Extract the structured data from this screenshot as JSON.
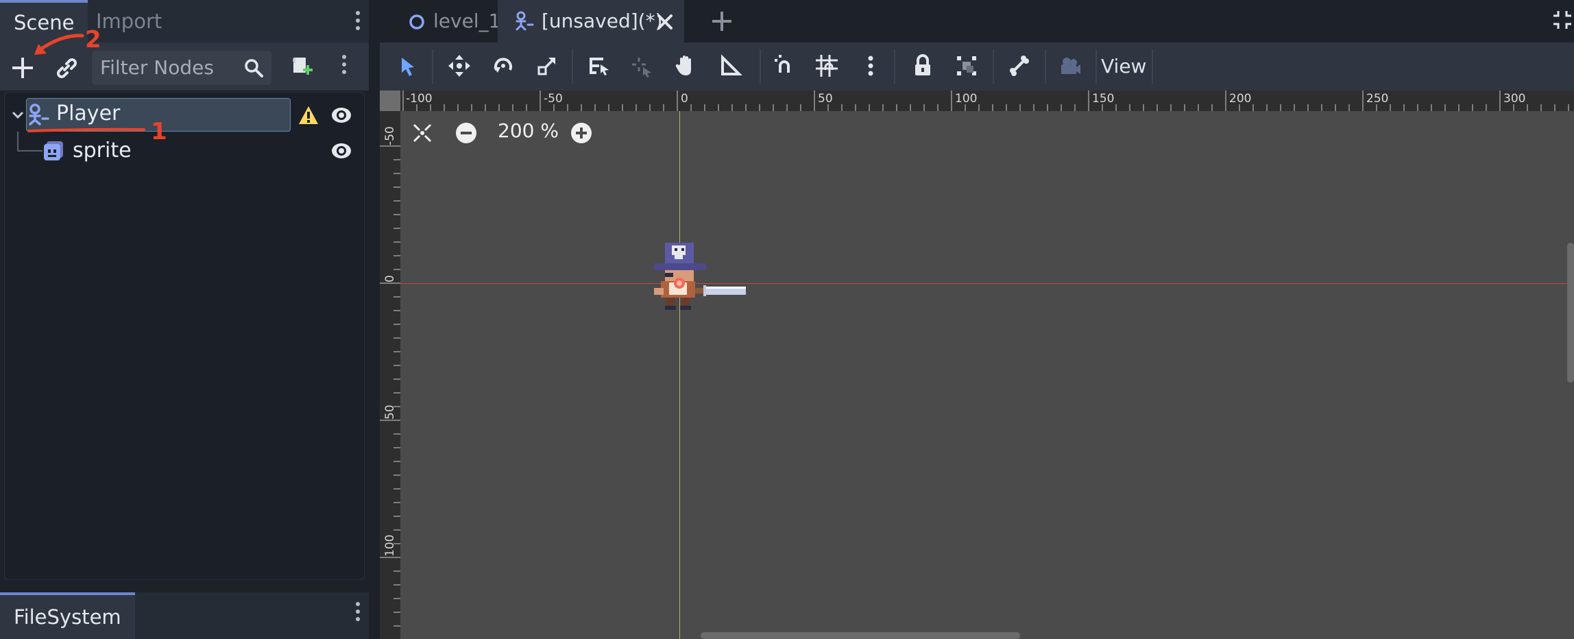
{
  "scene_dock": {
    "tabs": [
      {
        "label": "Scene"
      },
      {
        "label": "Import"
      }
    ],
    "filter_placeholder": "Filter Nodes",
    "tree": [
      {
        "label": "Player",
        "icon": "character-body-icon",
        "warning": true,
        "visible": true
      },
      {
        "label": "sprite",
        "icon": "sprite-icon",
        "visible": true
      }
    ],
    "annotations": {
      "marker_1": "1",
      "marker_2": "2",
      "color": "#e8442a"
    }
  },
  "filesystem_dock": {
    "tab_label": "FileSystem"
  },
  "editor_tabs": [
    {
      "label": "level_1",
      "icon": "circle-node-icon"
    },
    {
      "label": "[unsaved](*)",
      "icon": "character-body-icon",
      "active": true
    }
  ],
  "toolbar": {
    "view_label": "View"
  },
  "viewport": {
    "zoom_label": "200 %",
    "ruler_top_labels": [
      "-100",
      "-50",
      "0",
      "50",
      "100",
      "150",
      "200",
      "250",
      "300"
    ],
    "ruler_left_labels": [
      "-50",
      "0",
      "50",
      "100"
    ]
  },
  "colors": {
    "accent": "#6d86cc",
    "warning": "#ffd85e",
    "x_axis": "#c2464a",
    "y_axis": "#b5b562"
  }
}
